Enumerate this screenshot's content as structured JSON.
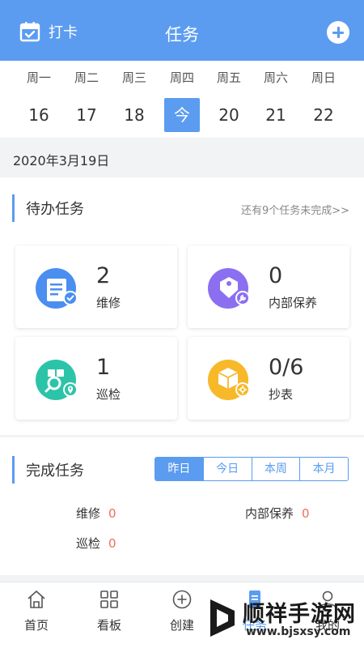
{
  "header": {
    "checkin_label": "打卡",
    "title": "任务",
    "checkin_icon": "calendar-check-icon",
    "add_icon": "plus-circle-icon"
  },
  "calendar": {
    "days": [
      {
        "weekday": "周一",
        "day": "16"
      },
      {
        "weekday": "周二",
        "day": "17"
      },
      {
        "weekday": "周三",
        "day": "18"
      },
      {
        "weekday": "周四",
        "day": "今"
      },
      {
        "weekday": "周五",
        "day": "20"
      },
      {
        "weekday": "周六",
        "day": "21"
      },
      {
        "weekday": "周日",
        "day": "22"
      }
    ]
  },
  "date_label": "2020年3月19日",
  "pending": {
    "title": "待办任务",
    "more_link": "还有9个任务未完成>>",
    "cards": [
      {
        "count": "2",
        "label": "维修",
        "icon": "repair-document-icon"
      },
      {
        "count": "0",
        "label": "内部保养",
        "icon": "maintenance-tag-icon"
      },
      {
        "count": "1",
        "label": "巡检",
        "icon": "inspection-icon"
      },
      {
        "count": "0/6",
        "label": "抄表",
        "icon": "meter-box-icon"
      }
    ]
  },
  "completed": {
    "title": "完成任务",
    "tabs": [
      "昨日",
      "今日",
      "本周",
      "本月"
    ],
    "stats": [
      {
        "label": "维修",
        "value": "0"
      },
      {
        "label": "内部保养",
        "value": "0"
      },
      {
        "label": "巡检",
        "value": "0"
      }
    ]
  },
  "tabbar": {
    "items": [
      {
        "label": "首页",
        "icon": "home-icon"
      },
      {
        "label": "看板",
        "icon": "grid-icon"
      },
      {
        "label": "创建",
        "icon": "plus-circle-icon"
      },
      {
        "label": "任务",
        "icon": "task-icon"
      },
      {
        "label": "我的",
        "icon": "user-icon"
      }
    ]
  },
  "watermark": {
    "name": "顺祥手游网",
    "url": "www.bjsxsy.com"
  },
  "colors": {
    "primary": "#5b9cf0",
    "danger": "#f26b5b",
    "repair": "#4a8ef0",
    "maintenance": "#8c6ff0",
    "inspection": "#2cc4a8",
    "meter": "#f7b82a"
  }
}
